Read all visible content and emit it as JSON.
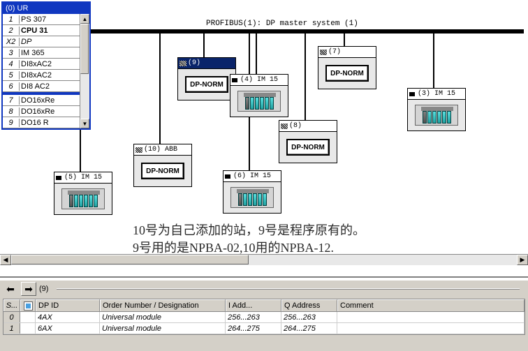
{
  "ur": {
    "title": "(0) UR",
    "rows_top": [
      {
        "slot": "1",
        "name": "PS 307"
      },
      {
        "slot": "2",
        "name": "CPU 31",
        "bold": true
      },
      {
        "slot": "X2",
        "name": "DP",
        "italic": true
      },
      {
        "slot": "3",
        "name": "IM 365"
      },
      {
        "slot": "4",
        "name": "DI8xAC2"
      },
      {
        "slot": "5",
        "name": "DI8xAC2"
      },
      {
        "slot": "6",
        "name": "DI8 AC2"
      }
    ],
    "rows_bottom": [
      {
        "slot": "7",
        "name": "DO16xRe"
      },
      {
        "slot": "8",
        "name": "DO16xRe"
      },
      {
        "slot": "9",
        "name": "DO16 R"
      }
    ]
  },
  "bus": {
    "label": "PROFIBUS(1): DP master system (1)"
  },
  "nodes": {
    "n9": {
      "label": "(9)",
      "type": "dpnorm",
      "selected": true
    },
    "n4": {
      "label": "(4) IM 15",
      "type": "rack"
    },
    "n7": {
      "label": "(7)",
      "type": "dpnorm"
    },
    "n3": {
      "label": "(3) IM 15",
      "type": "rack"
    },
    "n10": {
      "label": "(10) ABB",
      "type": "dpnorm"
    },
    "n8": {
      "label": "(8)",
      "type": "dpnorm"
    },
    "n5": {
      "label": "(5) IM 15",
      "type": "rack"
    },
    "n6": {
      "label": "(6) IM 15",
      "type": "rack"
    }
  },
  "dpnorm_text": "DP-NORM",
  "annotation": {
    "l1": "10号为自己添加的站，9号是程序原有的。",
    "l2": "9号用的是NPBA-02,10用的NPBA-12."
  },
  "bottom": {
    "path": "(9)",
    "headers": {
      "s": "S...",
      "id": "DP ID",
      "order": "Order Number / Designation",
      "iaddr": "I Add...",
      "qaddr": "Q Address",
      "comment": "Comment"
    },
    "rows": [
      {
        "s": "0",
        "id": "4AX",
        "order": "Universal module",
        "iaddr": "256...263",
        "qaddr": "256...263"
      },
      {
        "s": "1",
        "id": "6AX",
        "order": "Universal module",
        "iaddr": "264...275",
        "qaddr": "264...275"
      }
    ]
  }
}
